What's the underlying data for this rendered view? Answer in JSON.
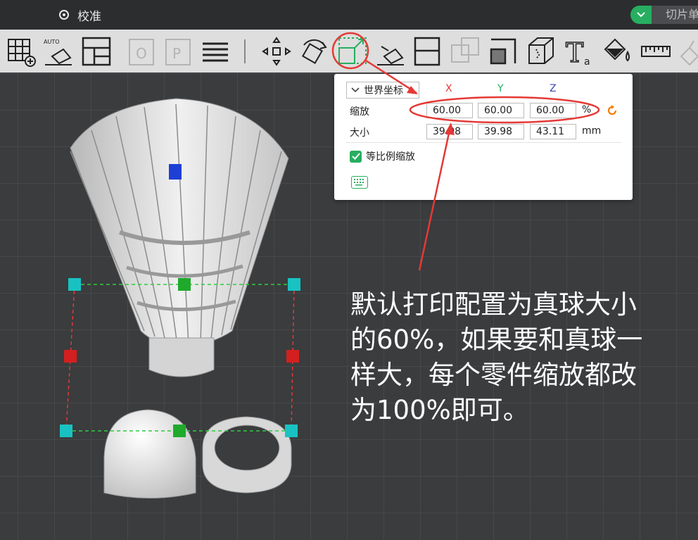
{
  "topbar": {
    "menu_label": "校准",
    "slice_label": "切片单"
  },
  "toolbar": {
    "tools": [
      {
        "name": "add-plate-icon"
      },
      {
        "name": "auto-orient-icon",
        "label": "AUTO"
      },
      {
        "name": "arrange-icon"
      },
      {
        "name": "plate-o-icon",
        "label": "O"
      },
      {
        "name": "plate-p-icon",
        "label": "P"
      },
      {
        "name": "layers-icon"
      },
      {
        "name": "move-icon"
      },
      {
        "name": "rotate-icon"
      },
      {
        "name": "scale-icon"
      },
      {
        "name": "lay-on-face-icon"
      },
      {
        "name": "cut-icon"
      },
      {
        "name": "boolean-icon"
      },
      {
        "name": "support-paint-icon"
      },
      {
        "name": "seam-paint-icon"
      },
      {
        "name": "text-icon",
        "label": "T",
        "sub": "a"
      },
      {
        "name": "color-paint-icon"
      },
      {
        "name": "measure-icon"
      },
      {
        "name": "assembly-icon"
      }
    ]
  },
  "scale_panel": {
    "coord_system": "世界坐标",
    "axes": [
      "X",
      "Y",
      "Z"
    ],
    "scale_label": "缩放",
    "scale_values": [
      "60.00",
      "60.00",
      "60.00"
    ],
    "scale_unit": "%",
    "size_label": "大小",
    "size_values": [
      "39.98",
      "39.98",
      "43.11"
    ],
    "size_unit": "mm",
    "uniform_label": "等比例缩放",
    "uniform_checked": true
  },
  "annotation": {
    "lines": [
      "默认打印配置为真球大小",
      "的60%，如果要和真球一",
      "样大，每个零件缩放都改",
      "为100%即可。"
    ]
  },
  "colors": {
    "accent": "#27ae60",
    "highlight": "#e53935",
    "axis_x": "#e53935",
    "axis_y": "#27ae60",
    "axis_z": "#3949ab",
    "viewport_bg": "#3a3c3e"
  }
}
